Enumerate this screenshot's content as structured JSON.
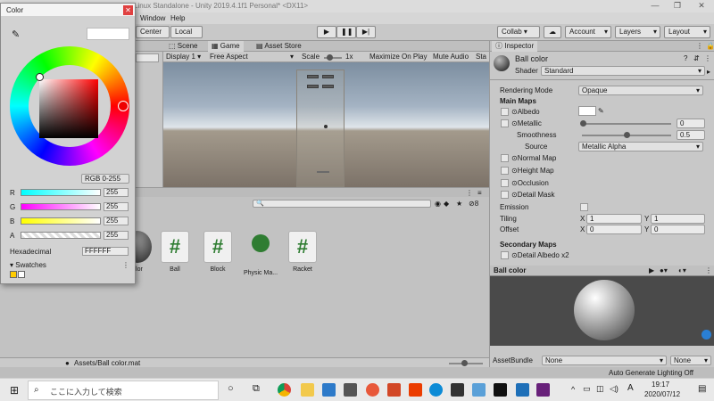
{
  "window": {
    "title": "Linux Standalone - Unity 2019.4.1f1 Personal* <DX11>",
    "controls": [
      "—",
      "❐",
      "✕"
    ]
  },
  "menu": {
    "items": [
      "Window",
      "Help"
    ]
  },
  "toolbar": {
    "center_label": "Center",
    "local_label": "Local",
    "collab_label": "Collab ▾",
    "account_label": "Account",
    "layers_label": "Layers",
    "layout_label": "Layout"
  },
  "tabs": {
    "scene": "Scene",
    "game": "Game",
    "asset_store": "Asset Store"
  },
  "game_toolbar": {
    "display": "Display 1",
    "aspect": "Free Aspect",
    "scale_label": "Scale",
    "scale_value": "1x",
    "maximize": "Maximize On Play",
    "mute": "Mute Audio",
    "stats": "Sta"
  },
  "project": {
    "assets": [
      {
        "name": "olor",
        "icon": "material-sphere"
      },
      {
        "name": "Ball",
        "icon": "script-hash-icon"
      },
      {
        "name": "Block",
        "icon": "script-hash-icon"
      },
      {
        "name": "Physic Ma...",
        "icon": "physic-material-icon"
      },
      {
        "name": "Racket",
        "icon": "script-hash-icon"
      }
    ],
    "count_badge": "8",
    "footer_path": "Assets/Ball color.mat"
  },
  "inspector": {
    "tab": "Inspector",
    "material_name": "Ball color",
    "shader_label": "Shader",
    "shader_value": "Standard",
    "rendering_mode_label": "Rendering Mode",
    "rendering_mode_value": "Opaque",
    "main_maps": "Main Maps",
    "albedo": "Albedo",
    "metallic": "Metallic",
    "metallic_value": "0",
    "smoothness": "Smoothness",
    "smoothness_value": "0.5",
    "source": "Source",
    "source_value": "Metallic Alpha",
    "normal_map": "Normal Map",
    "height_map": "Height Map",
    "occlusion": "Occlusion",
    "detail_mask": "Detail Mask",
    "emission": "Emission",
    "tiling": "Tiling",
    "offset": "Offset",
    "tiling_x": "1",
    "tiling_y": "1",
    "offset_x": "0",
    "offset_y": "0",
    "x_label": "X",
    "y_label": "Y",
    "secondary_maps": "Secondary Maps",
    "detail_albedo": "Detail Albedo x2",
    "preview_title": "Ball color",
    "assetbundle_label": "AssetBundle",
    "assetbundle_value": "None",
    "assetbundle_variant": "None"
  },
  "status": {
    "lighting": "Auto Generate Lighting Off"
  },
  "color_picker": {
    "title": "Color",
    "mode": "RGB 0-255",
    "channels": [
      {
        "label": "R",
        "value": "255",
        "color": "#00ffff"
      },
      {
        "label": "G",
        "value": "255",
        "color": "#ff00ff"
      },
      {
        "label": "B",
        "value": "255",
        "color": "#ffff00"
      },
      {
        "label": "A",
        "value": "255",
        "color": "#ffffff"
      }
    ],
    "hex_label": "Hexadecimal",
    "hex_value": "FFFFFF",
    "swatches_label": "Swatches"
  },
  "taskbar": {
    "search_placeholder": "ここに入力して検索",
    "time": "19:17",
    "date": "2020/07/12",
    "ime": "A"
  }
}
